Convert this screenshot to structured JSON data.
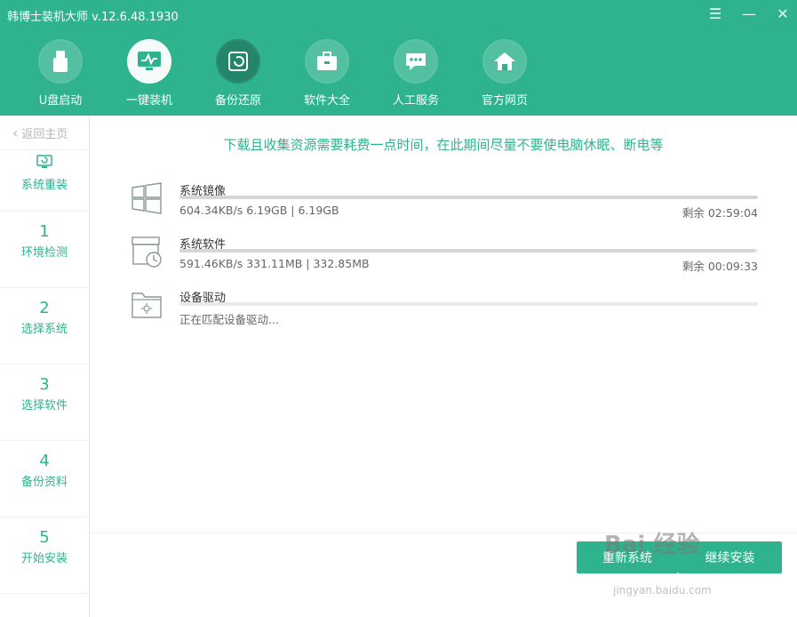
{
  "window": {
    "title": "韩博士装机大师 v.12.6.48.1930"
  },
  "nav": {
    "items": [
      {
        "label": "U盘启动",
        "icon": "usb-icon"
      },
      {
        "label": "一键装机",
        "icon": "monitor-icon",
        "active": true
      },
      {
        "label": "备份还原",
        "icon": "restore-icon"
      },
      {
        "label": "软件大全",
        "icon": "briefcase-icon"
      },
      {
        "label": "人工服务",
        "icon": "chat-icon"
      },
      {
        "label": "官方网页",
        "icon": "home-icon"
      }
    ]
  },
  "sidebar": {
    "back_label": "返回主页",
    "steps": [
      {
        "num": "",
        "label": "系统重装"
      },
      {
        "num": "1",
        "label": "环境检测"
      },
      {
        "num": "2",
        "label": "选择系统"
      },
      {
        "num": "3",
        "label": "选择软件"
      },
      {
        "num": "4",
        "label": "备份资料"
      },
      {
        "num": "5",
        "label": "开始安装"
      }
    ]
  },
  "main": {
    "notice": "下载且收集资源需要耗费一点时间，在此期间尽量不要使电脑休眠、断电等",
    "downloads": [
      {
        "name": "系统镜像",
        "stat": "604.34KB/s 6.19GB | 6.19GB",
        "remain": "剩余 02:59:04",
        "progress": 1.0
      },
      {
        "name": "系统软件",
        "stat": "591.46KB/s 331.11MB | 332.85MB",
        "remain": "剩余 00:09:33",
        "progress": 0.995
      },
      {
        "name": "设备驱动",
        "stat": "正在匹配设备驱动...",
        "remain": "",
        "progress": 0.0
      }
    ]
  },
  "buttons": {
    "left": "重新系统",
    "right": "继续安装"
  },
  "watermark": {
    "text": "Bai 经验",
    "sub": "jingyan.baidu.com"
  },
  "colors": {
    "accent": "#2fb38e"
  }
}
